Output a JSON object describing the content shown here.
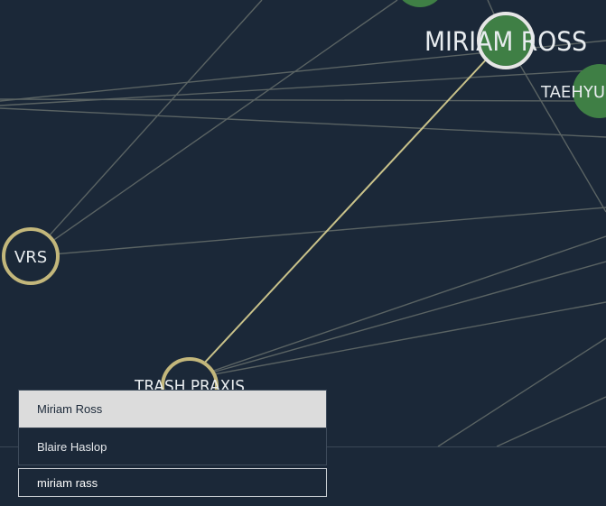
{
  "graph": {
    "nodes": [
      {
        "id": "miriam-ross",
        "label": "MIRIAM ROSS",
        "kind": "selected",
        "ring": "#e6e6e6",
        "fill": "#3f7f45"
      },
      {
        "id": "taehyun",
        "label": "TAEHYUN",
        "kind": "person",
        "ring": "#3f7f45",
        "fill": "#3f7f45"
      },
      {
        "id": "vrs",
        "label": "VRS",
        "kind": "group",
        "ring": "#c3b77b",
        "fill": "#1b2838"
      },
      {
        "id": "trash-praxis",
        "label": "TRASH PRAXIS",
        "kind": "group",
        "ring": "#c3b77b",
        "fill": "#1b2838"
      },
      {
        "id": "top-node",
        "label": "",
        "kind": "person",
        "ring": "#3f7f45",
        "fill": "#3f7f45"
      }
    ],
    "colors": {
      "background": "#1b2838",
      "edge": "#5a6363",
      "highlight_edge": "#c9c28a",
      "person": "#3f7f45",
      "group_ring": "#c3b77b"
    }
  },
  "search": {
    "value": "miriam rass",
    "suggestions": [
      {
        "label": "Miriam Ross",
        "active": true
      },
      {
        "label": "Blaire Haslop",
        "active": false
      }
    ]
  }
}
